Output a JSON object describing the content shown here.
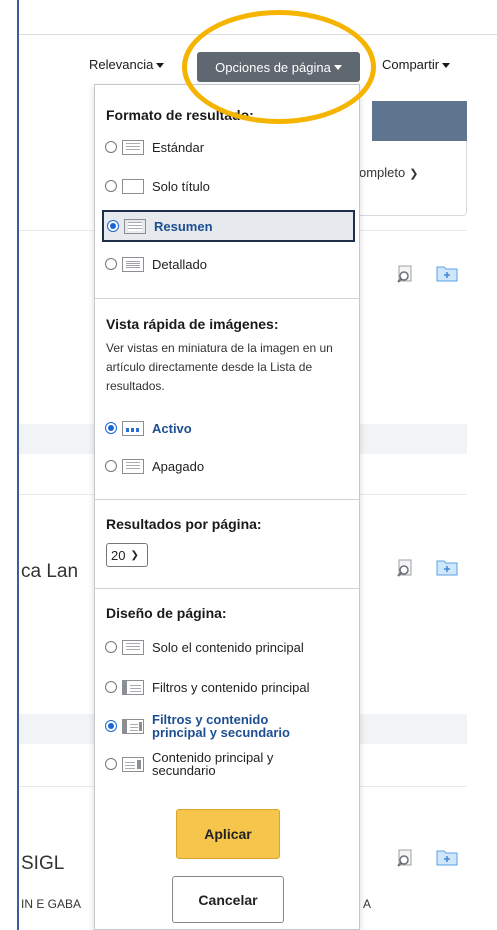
{
  "toolbar": {
    "relevance_label": "Relevancia",
    "page_options_label": "Opciones de página",
    "share_label": "Compartir"
  },
  "background": {
    "view_label": "ompleto",
    "result_title_fragment_1": "ca Lan",
    "result_title_fragment_2": "SIGL",
    "result_author_fragment_left": "IN E GABA",
    "result_author_fragment_right": "A"
  },
  "panel": {
    "format": {
      "title": "Formato de resultado:",
      "options": [
        "Estándar",
        "Solo título",
        "Resumen",
        "Detallado"
      ],
      "selected": "Resumen"
    },
    "image_quick_view": {
      "title": "Vista rápida de imágenes:",
      "description": "Ver vistas en miniatura de la imagen en un artículo directamente desde la Lista de resultados.",
      "options": [
        "Activo",
        "Apagado"
      ],
      "selected": "Activo"
    },
    "results_per_page": {
      "title": "Resultados por página:",
      "value": "20"
    },
    "page_layout": {
      "title": "Diseño de página:",
      "options": [
        "Solo el contenido principal",
        "Filtros y contenido principal",
        "Filtros y contenido principal y secundario",
        "Contenido principal y secundario"
      ],
      "selected": "Filtros y contenido principal y secundario"
    },
    "apply_label": "Aplicar",
    "cancel_label": "Cancelar"
  },
  "colors": {
    "accent_blue": "#1d4f91",
    "apply_yellow": "#f6c54b",
    "highlight_ring": "#f4b400",
    "toolbar_active": "#5f6771"
  }
}
